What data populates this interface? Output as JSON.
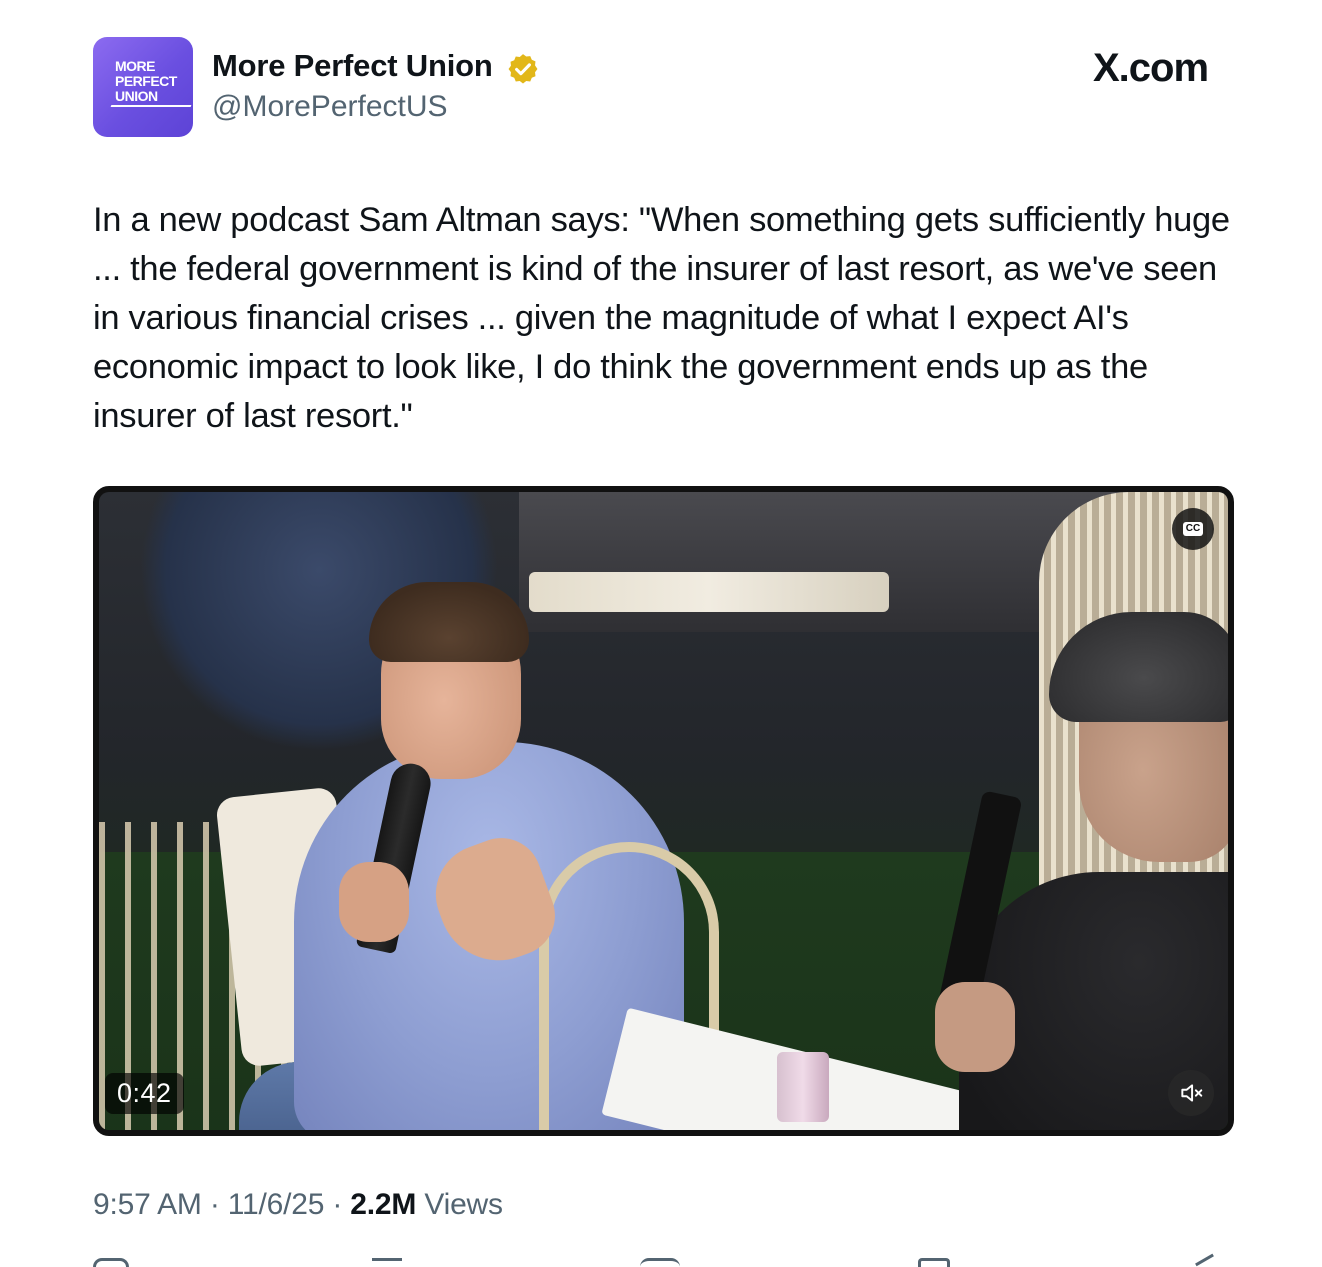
{
  "author": {
    "avatar_lines": [
      "MORE",
      "PERFECT",
      "UNION"
    ],
    "name": "More Perfect Union",
    "handle": "@MorePerfectUS",
    "verified_icon": "gold-verified-badge-icon",
    "verified_color": "#e2b719"
  },
  "brand": {
    "site": "X.com"
  },
  "tweet": {
    "text": "In a new podcast Sam Altman says: \"When something gets sufficiently huge ... the federal government is kind of the insurer of last resort, as we've seen in various financial crises ... given the magnitude of what I expect AI's economic impact to look like, I do think the government ends up as the insurer of last resort.\""
  },
  "video": {
    "cc_label": "CC",
    "duration": "0:42",
    "mute_icon": "speaker-muted-icon"
  },
  "meta": {
    "time": "9:57 AM",
    "separator": "·",
    "date": "11/6/25",
    "views_count": "2.2M",
    "views_label": "Views"
  },
  "actions": {
    "icons": [
      "reply-icon",
      "repost-icon",
      "like-icon",
      "bookmark-icon",
      "share-icon"
    ]
  }
}
